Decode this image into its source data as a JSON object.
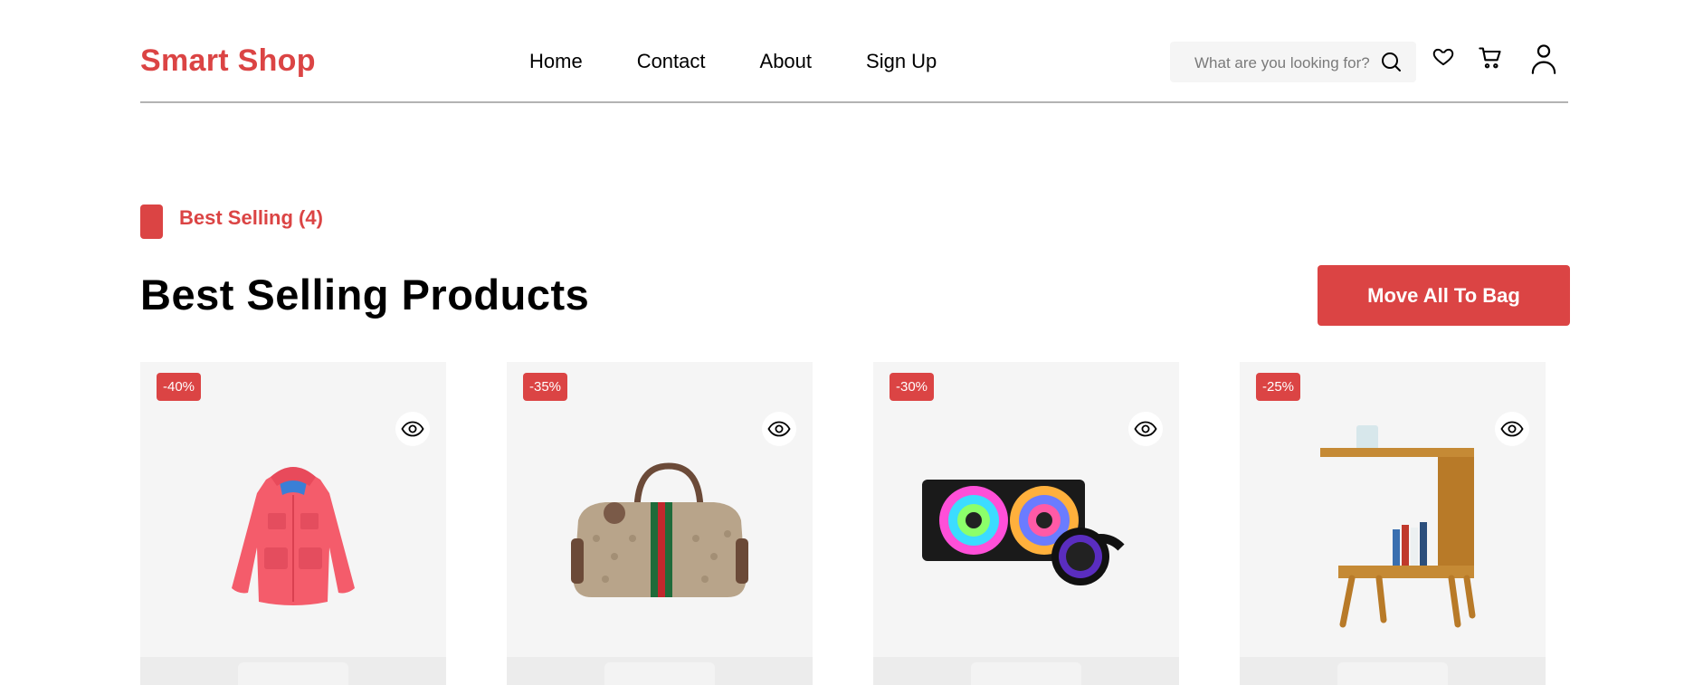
{
  "header": {
    "logo": "Smart Shop",
    "nav": [
      "Home",
      "Contact",
      "About",
      "Sign Up"
    ],
    "search_placeholder": "What are you looking for?"
  },
  "section": {
    "tag": "Best Selling (4)",
    "title": "Best Selling Products",
    "button": "Move All To Bag"
  },
  "products": [
    {
      "discount": "-40%",
      "image": "pink-jacket"
    },
    {
      "discount": "-35%",
      "image": "monogram-duffle-bag"
    },
    {
      "discount": "-30%",
      "image": "rgb-liquid-cooler"
    },
    {
      "discount": "-25%",
      "image": "wooden-side-table"
    }
  ],
  "colors": {
    "accent": "#db4444",
    "card_bg": "#f5f5f5"
  }
}
